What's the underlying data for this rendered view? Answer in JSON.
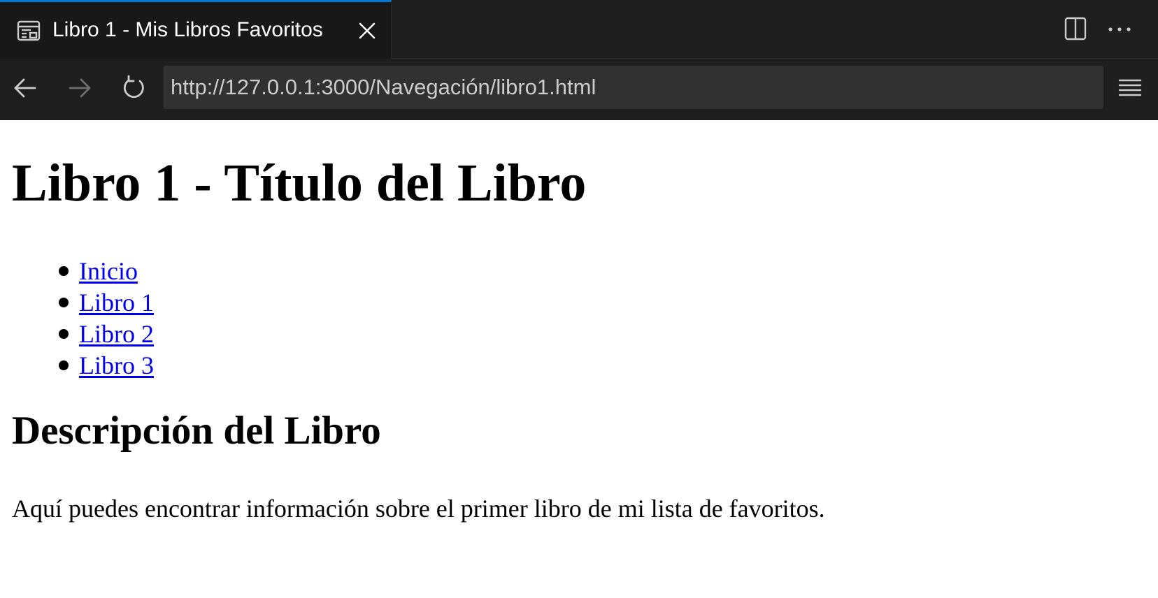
{
  "tab": {
    "title": "Libro 1 - Mis Libros Favoritos",
    "icon": "preview-icon",
    "accent": "#0078d4"
  },
  "toolbar": {
    "split_icon": "split-editor-icon",
    "more_icon": "more-actions-icon"
  },
  "navigation": {
    "back_icon": "arrow-left-icon",
    "forward_icon": "arrow-right-icon",
    "reload_icon": "reload-icon",
    "url": "http://127.0.0.1:3000/Navegación/libro1.html",
    "menu_icon": "hamburger-menu-icon"
  },
  "page": {
    "heading": "Libro 1 - Título del Libro",
    "nav_links": [
      "Inicio",
      "Libro 1",
      "Libro 2",
      "Libro 3"
    ],
    "subheading": "Descripción del Libro",
    "paragraph": "Aquí puedes encontrar información sobre el primer libro de mi lista de favoritos.",
    "link_color": "#0000ee"
  },
  "colors": {
    "chrome_bg": "#1f1f1f",
    "tab_bg": "#181818",
    "url_bg": "#313131"
  }
}
